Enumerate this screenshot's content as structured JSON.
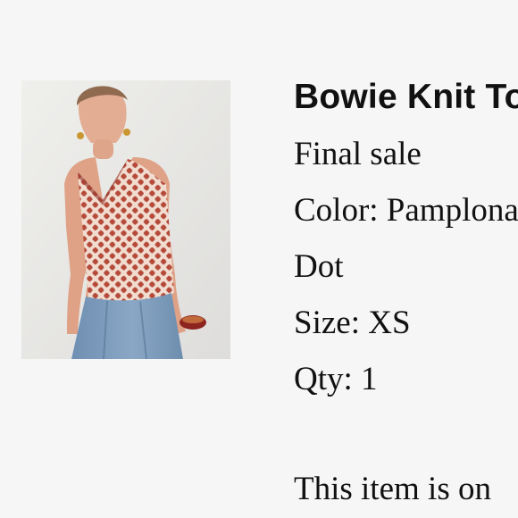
{
  "product": {
    "image_alt": "Model wearing red polka dot halter knit top with blue jeans",
    "title": "Bowie Knit Top",
    "status": "Final sale",
    "color_line": "Color: Pamplona",
    "color_line_2": "Dot",
    "size_line": "Size: XS",
    "qty_line": "Qty: 1",
    "notice": "This item is on"
  },
  "colors": {
    "background": "#f6f6f6",
    "text": "#111111",
    "top_red": "#b54a3a",
    "top_cream": "#f1ddd0",
    "denim": "#7c9bbb"
  }
}
